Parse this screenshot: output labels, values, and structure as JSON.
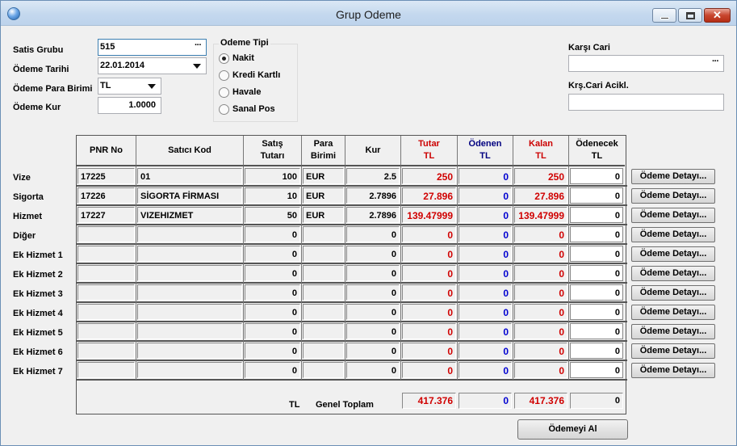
{
  "window": {
    "title": "Grup Odeme"
  },
  "form": {
    "satis_grubu_label": "Satis Grubu",
    "satis_grubu_value": "515",
    "odeme_tarihi_label": "Ödeme Tarihi",
    "odeme_tarihi_value": "22.01.2014",
    "para_birimi_label": "Ödeme Para Birimi",
    "para_birimi_value": "TL",
    "odeme_kur_label": "Ödeme Kur",
    "odeme_kur_value": "1.0000",
    "dots": "···"
  },
  "odeme_tipi": {
    "title": "Odeme Tipi",
    "options": [
      "Nakit",
      "Kredi Kartlı",
      "Havale",
      "Sanal Pos"
    ],
    "selected": "Nakit"
  },
  "cari": {
    "karsi_cari_label": "Karşı Cari",
    "karsi_cari_value": "",
    "aciklama_label": "Krş.Cari Acikl.",
    "aciklama_value": ""
  },
  "table": {
    "headers": {
      "pnr": "PNR No",
      "satici": "Satıcı Kod",
      "satis_l1": "Satış",
      "satis_l2": "Tutarı",
      "para_l1": "Para",
      "para_l2": "Birimi",
      "kur": "Kur",
      "tutar_l1": "Tutar",
      "tutar_l2": "TL",
      "odenen_l1": "Ödenen",
      "odenen_l2": "TL",
      "kalan_l1": "Kalan",
      "kalan_l2": "TL",
      "odenecek_l1": "Ödenecek",
      "odenecek_l2": "TL"
    },
    "rows": [
      {
        "label": "Vize",
        "pnr": "17225",
        "satici": "01",
        "satis": "100",
        "para": "EUR",
        "kur": "2.5",
        "tutar": "250",
        "odenen": "0",
        "kalan": "250",
        "odenecek": "0"
      },
      {
        "label": "Sigorta",
        "pnr": "17226",
        "satici": "SİGORTA FİRMASI",
        "satis": "10",
        "para": "EUR",
        "kur": "2.7896",
        "tutar": "27.896",
        "odenen": "0",
        "kalan": "27.896",
        "odenecek": "0"
      },
      {
        "label": "Hizmet",
        "pnr": "17227",
        "satici": "VIZEHIZMET",
        "satis": "50",
        "para": "EUR",
        "kur": "2.7896",
        "tutar": "139.47999",
        "odenen": "0",
        "kalan": "139.47999",
        "odenecek": "0"
      },
      {
        "label": "Diğer",
        "pnr": "",
        "satici": "",
        "satis": "0",
        "para": "",
        "kur": "0",
        "tutar": "0",
        "odenen": "0",
        "kalan": "0",
        "odenecek": "0"
      },
      {
        "label": "Ek Hizmet 1",
        "pnr": "",
        "satici": "",
        "satis": "0",
        "para": "",
        "kur": "0",
        "tutar": "0",
        "odenen": "0",
        "kalan": "0",
        "odenecek": "0"
      },
      {
        "label": "Ek Hizmet 2",
        "pnr": "",
        "satici": "",
        "satis": "0",
        "para": "",
        "kur": "0",
        "tutar": "0",
        "odenen": "0",
        "kalan": "0",
        "odenecek": "0"
      },
      {
        "label": "Ek Hizmet 3",
        "pnr": "",
        "satici": "",
        "satis": "0",
        "para": "",
        "kur": "0",
        "tutar": "0",
        "odenen": "0",
        "kalan": "0",
        "odenecek": "0"
      },
      {
        "label": "Ek Hizmet 4",
        "pnr": "",
        "satici": "",
        "satis": "0",
        "para": "",
        "kur": "0",
        "tutar": "0",
        "odenen": "0",
        "kalan": "0",
        "odenecek": "0"
      },
      {
        "label": "Ek Hizmet 5",
        "pnr": "",
        "satici": "",
        "satis": "0",
        "para": "",
        "kur": "0",
        "tutar": "0",
        "odenen": "0",
        "kalan": "0",
        "odenecek": "0"
      },
      {
        "label": "Ek Hizmet 6",
        "pnr": "",
        "satici": "",
        "satis": "0",
        "para": "",
        "kur": "0",
        "tutar": "0",
        "odenen": "0",
        "kalan": "0",
        "odenecek": "0"
      },
      {
        "label": "Ek Hizmet 7",
        "pnr": "",
        "satici": "",
        "satis": "0",
        "para": "",
        "kur": "0",
        "tutar": "0",
        "odenen": "0",
        "kalan": "0",
        "odenecek": "0"
      }
    ],
    "detail_button_label": "Ödeme Detayı...",
    "footer": {
      "currency": "TL",
      "label": "Genel Toplam",
      "tutar": "417.376",
      "odenen": "0",
      "kalan": "417.376",
      "odenecek": "0"
    }
  },
  "actions": {
    "odeme_al_label": "Ödemeyi Al"
  },
  "colors": {
    "red_values": "#d00000",
    "blue_values": "#0000d0",
    "header_red": "#cc0000",
    "header_navy": "#000080"
  }
}
